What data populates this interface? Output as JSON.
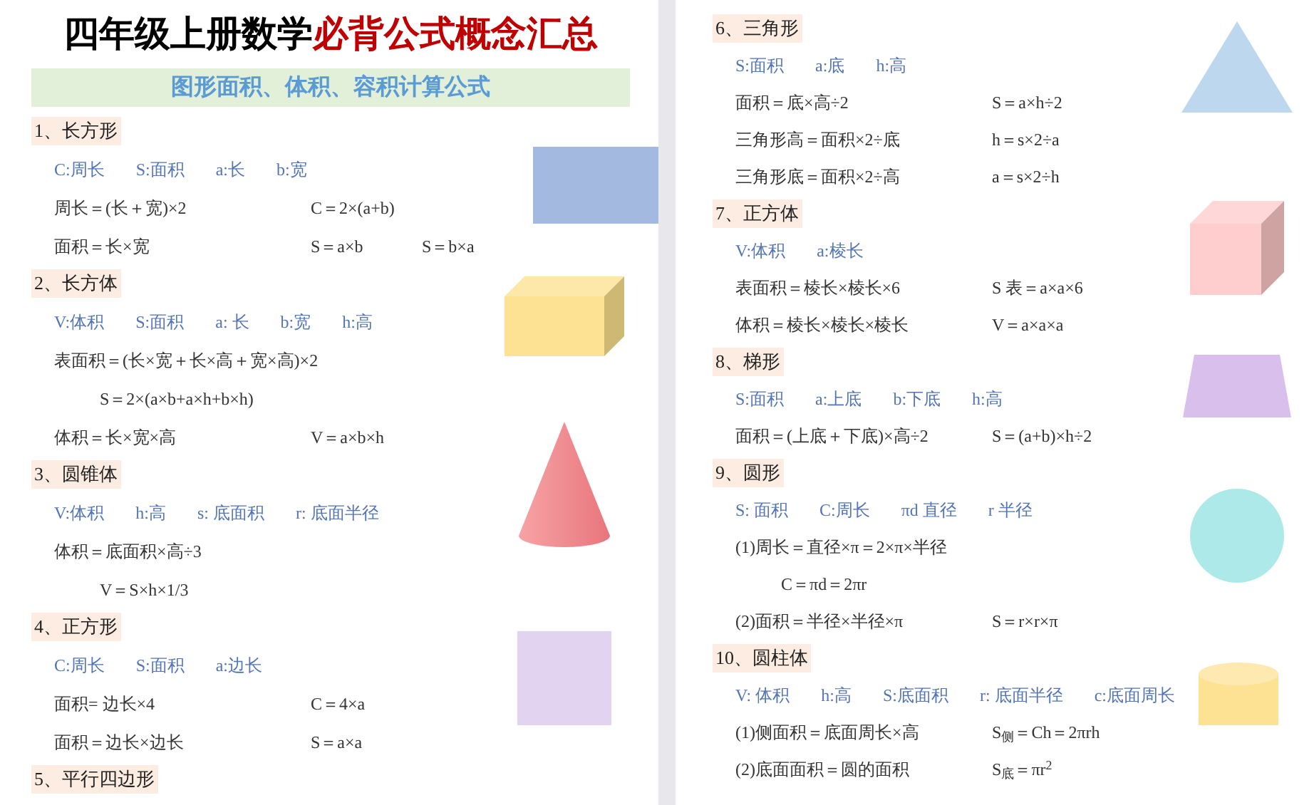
{
  "pages": [
    {
      "title": {
        "plain": "四年级上册数学",
        "accent": "必背公式概念汇总"
      },
      "banner": "图形面积、体积、容积计算公式",
      "sections": [
        {
          "heading": "1、长方形",
          "shape": {
            "kind": "rectangle",
            "color": "#a3b9e0"
          },
          "lines": [
            {
              "kind": "legend",
              "items": [
                "C:周长",
                "S:面积",
                "a:长",
                "b:宽"
              ]
            },
            {
              "kind": "formula",
              "items": [
                "周长＝(长＋宽)×2",
                "C＝2×(a+b)"
              ]
            },
            {
              "kind": "formula",
              "items": [
                "面积＝长×宽",
                "S＝a×b",
                "S＝b×a"
              ]
            }
          ]
        },
        {
          "heading": "2、长方体",
          "shape": {
            "kind": "cuboid",
            "color": "#fde293"
          },
          "lines": [
            {
              "kind": "legend",
              "items": [
                "V:体积",
                "S:面积",
                "a: 长",
                "b:宽",
                "h:高"
              ]
            },
            {
              "kind": "formula",
              "items": [
                "表面积＝(长×宽＋长×高＋宽×高)×2"
              ]
            },
            {
              "kind": "sub",
              "items": [
                "S＝2×(a×b+a×h+b×h)"
              ]
            },
            {
              "kind": "formula",
              "items": [
                "体积＝长×宽×高",
                "V＝a×b×h"
              ]
            }
          ]
        },
        {
          "heading": "3、圆锥体",
          "shape": {
            "kind": "cone",
            "color": "#e8767c"
          },
          "lines": [
            {
              "kind": "legend",
              "items": [
                "V:体积",
                "h:高",
                "s: 底面积",
                "r: 底面半径"
              ]
            },
            {
              "kind": "formula",
              "items": [
                "体积＝底面积×高÷3"
              ]
            },
            {
              "kind": "sub",
              "items": [
                "V＝S×h×1/3"
              ]
            }
          ]
        },
        {
          "heading": "4、正方形",
          "shape": {
            "kind": "square",
            "color": "#e2d4f0"
          },
          "lines": [
            {
              "kind": "legend",
              "items": [
                "C:周长",
                "S:面积",
                "a:边长"
              ]
            },
            {
              "kind": "formula",
              "items": [
                "面积= 边长×4",
                "C＝4×a"
              ]
            },
            {
              "kind": "formula",
              "items": [
                "面积＝边长×边长",
                "S＝a×a"
              ]
            }
          ]
        },
        {
          "heading": "5、平行四边形"
        }
      ]
    },
    {
      "sections": [
        {
          "heading": "6、三角形",
          "shape": {
            "kind": "triangle",
            "color": "#bdd7ee"
          },
          "lines": [
            {
              "kind": "legend",
              "items": [
                "S:面积",
                "a:底",
                "h:高"
              ]
            },
            {
              "kind": "formula",
              "items": [
                "面积＝底×高÷2",
                "S＝a×h÷2"
              ]
            },
            {
              "kind": "formula",
              "items": [
                "三角形高＝面积×2÷底",
                "h＝s×2÷a"
              ]
            },
            {
              "kind": "formula",
              "items": [
                "三角形底＝面积×2÷高",
                "a＝s×2÷h"
              ]
            }
          ]
        },
        {
          "heading": "7、正方体",
          "shape": {
            "kind": "cube",
            "color": "#fecece"
          },
          "lines": [
            {
              "kind": "legend",
              "items": [
                "V:体积",
                "a:棱长"
              ]
            },
            {
              "kind": "formula",
              "items": [
                "表面积＝棱长×棱长×6",
                "S 表＝a×a×6"
              ]
            },
            {
              "kind": "formula",
              "items": [
                "体积＝棱长×棱长×棱长",
                "V＝a×a×a"
              ]
            }
          ]
        },
        {
          "heading": "8、梯形",
          "shape": {
            "kind": "trapezoid",
            "color": "#d9bfec"
          },
          "lines": [
            {
              "kind": "legend",
              "items": [
                "S:面积",
                "a:上底",
                "b:下底",
                "h:高"
              ]
            },
            {
              "kind": "formula",
              "items": [
                "面积＝(上底＋下底)×高÷2",
                "S＝(a+b)×h÷2"
              ]
            }
          ]
        },
        {
          "heading": "9、圆形",
          "shape": {
            "kind": "circle",
            "color": "#ade9e8"
          },
          "lines": [
            {
              "kind": "legend",
              "items": [
                "S: 面积",
                "C:周长",
                "πd 直径",
                "r 半径"
              ]
            },
            {
              "kind": "formula",
              "items": [
                "(1)周长＝直径×π＝2×π×半径"
              ]
            },
            {
              "kind": "sub",
              "items": [
                "C＝πd＝2πr"
              ]
            },
            {
              "kind": "formula",
              "items": [
                "(2)面积＝半径×半径×π",
                "S＝r×r×π"
              ]
            }
          ]
        },
        {
          "heading": "10、圆柱体",
          "shape": {
            "kind": "cylinder",
            "color": "#fde293"
          },
          "lines": [
            {
              "kind": "legend",
              "items": [
                "V: 体积",
                "h:高",
                "S:底面积",
                "r: 底面半径",
                "c:底面周长"
              ]
            },
            {
              "kind": "formula",
              "items": [
                "(1)侧面积＝底面周长×高",
                "S$_{侧}$＝Ch＝2πrh"
              ]
            },
            {
              "kind": "formula",
              "items": [
                "(2)底面面积＝圆的面积",
                "S$_{底}$＝πr$^{2}$"
              ]
            }
          ]
        }
      ]
    }
  ]
}
